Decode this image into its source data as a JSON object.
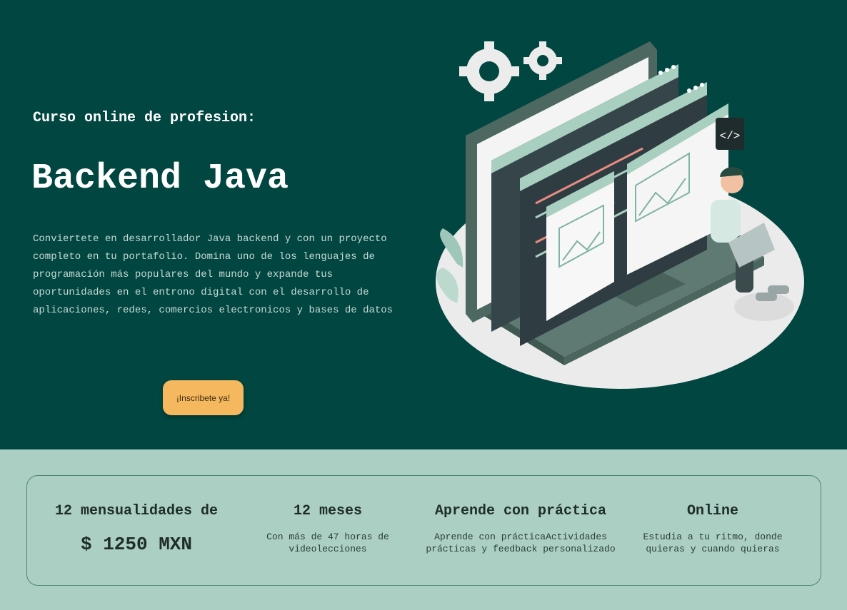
{
  "hero": {
    "subtitle": "Curso online de profesion:",
    "title": "Backend Java",
    "description": "Conviertete en desarrollador Java backend y con un proyecto completo en tu portafolio. Domina uno de los lenguajes de programación más populares del mundo y expande tus oportunidades en el entrono digital con el desarrollo de aplicaciones, redes, comercios electronicos y bases de datos",
    "cta_label": "¡Inscribete ya!",
    "illustration_code_tag": "</>"
  },
  "features": [
    {
      "title": "12 mensualidades de",
      "price": "$ 1250 MXN"
    },
    {
      "title": "12 meses",
      "description": "Con más de 47 horas de videolecciones"
    },
    {
      "title": "Aprende con práctica",
      "description": "Aprende con prácticaActividades prácticas y feedback personalizado"
    },
    {
      "title": "Online",
      "description": "Estudia a tu ritmo, donde quieras y cuando quieras"
    }
  ],
  "colors": {
    "hero_bg": "#014640",
    "features_bg": "#abcfc3",
    "cta_bg": "#f6b85e",
    "text_light": "#ffffff"
  },
  "icons": [
    "gear-icon",
    "code-tag-icon",
    "image-placeholder-icon",
    "laptop-icon"
  ]
}
